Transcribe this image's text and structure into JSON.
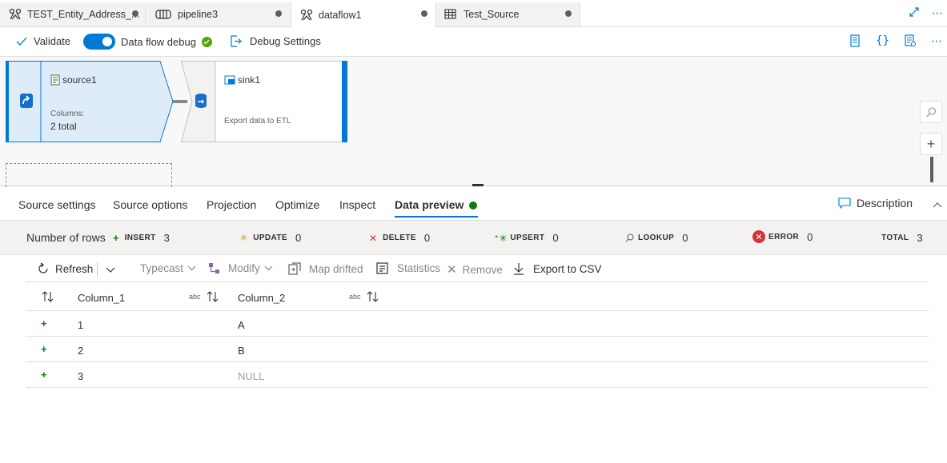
{
  "tabs": [
    {
      "label": "TEST_Entity_Address_...",
      "icon": "dataflow-icon"
    },
    {
      "label": "pipeline3",
      "icon": "pipeline-icon"
    },
    {
      "label": "dataflow1",
      "icon": "dataflow-icon"
    },
    {
      "label": "Test_Source",
      "icon": "table-icon"
    }
  ],
  "toolbar": {
    "validate": "Validate",
    "debug": "Data flow debug",
    "debug_settings": "Debug Settings"
  },
  "canvas": {
    "source": {
      "title": "source1",
      "columns_label": "Columns:",
      "columns_value": "2 total"
    },
    "sink": {
      "title": "sink1",
      "description": "Export data to ETL"
    }
  },
  "bottom_tabs": [
    "Source settings",
    "Source options",
    "Projection",
    "Optimize",
    "Inspect",
    "Data preview"
  ],
  "description": "Description",
  "summary": {
    "label": "Number of rows",
    "insert": {
      "label": "INSERT",
      "value": "3"
    },
    "update": {
      "label": "UPDATE",
      "value": "0"
    },
    "delete": {
      "label": "DELETE",
      "value": "0"
    },
    "upsert": {
      "label": "UPSERT",
      "value": "0"
    },
    "lookup": {
      "label": "LOOKUP",
      "value": "0"
    },
    "error": {
      "label": "ERROR",
      "value": "0"
    },
    "total": {
      "label": "TOTAL",
      "value": "3"
    }
  },
  "preview_toolbar": {
    "refresh": "Refresh",
    "typecast": "Typecast",
    "modify": "Modify",
    "map_drifted": "Map drifted",
    "statistics": "Statistics",
    "remove": "Remove",
    "export": "Export to CSV"
  },
  "table": {
    "type_label": "abc",
    "columns": [
      "Column_1",
      "Column_2"
    ],
    "rows": [
      [
        "1",
        "A"
      ],
      [
        "2",
        "B"
      ],
      [
        "3",
        "NULL"
      ]
    ]
  },
  "colors": {
    "accent": "#0078d4",
    "success": "#107c10",
    "error": "#d13438"
  }
}
